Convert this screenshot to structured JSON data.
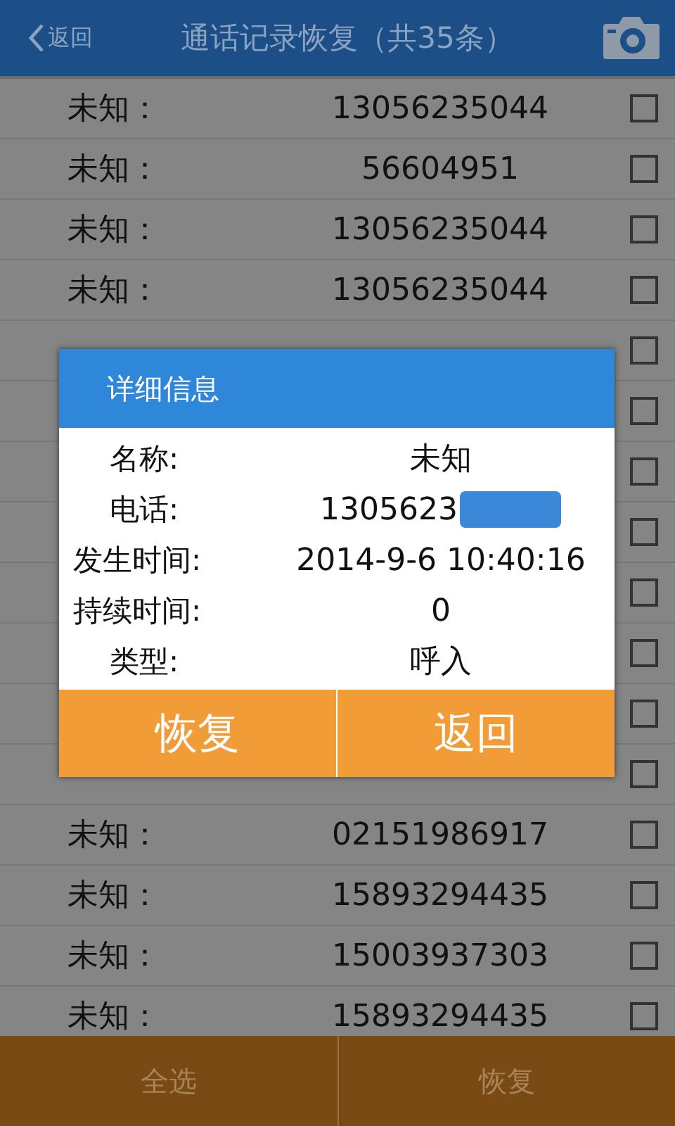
{
  "header": {
    "back_label": "返回",
    "title": "通话记录恢复（共35条）"
  },
  "records": [
    {
      "name": "未知：",
      "number": "13056235044",
      "checked": false
    },
    {
      "name": "未知：",
      "number": "56604951",
      "checked": false
    },
    {
      "name": "未知：",
      "number": "13056235044",
      "checked": false
    },
    {
      "name": "未知：",
      "number": "13056235044",
      "checked": false
    },
    {
      "checked": false
    },
    {
      "checked": false
    },
    {
      "checked": false
    },
    {
      "checked": false
    },
    {
      "checked": false
    },
    {
      "checked": false
    },
    {
      "checked": false
    },
    {
      "checked": false
    },
    {
      "name": "未知：",
      "number": "02151986917",
      "checked": false
    },
    {
      "name": "未知：",
      "number": "15893294435",
      "checked": false
    },
    {
      "name": "未知：",
      "number": "15003937303",
      "checked": false
    },
    {
      "name": "未知：",
      "number": "15893294435",
      "checked": false
    }
  ],
  "bottom_bar": [
    "全选",
    "恢复"
  ],
  "dialog": {
    "title": "详细信息",
    "fields": [
      {
        "label": "名称:",
        "value": "未知"
      },
      {
        "label": "电话:",
        "value": "1305623",
        "redacted": true
      },
      {
        "label": "发生时间:",
        "value": "2014-9-6 10:40:16"
      },
      {
        "label": "持续时间:",
        "value": "0"
      },
      {
        "label": "类型:",
        "value": "呼入"
      }
    ],
    "buttons": [
      "恢复",
      "返回"
    ]
  }
}
